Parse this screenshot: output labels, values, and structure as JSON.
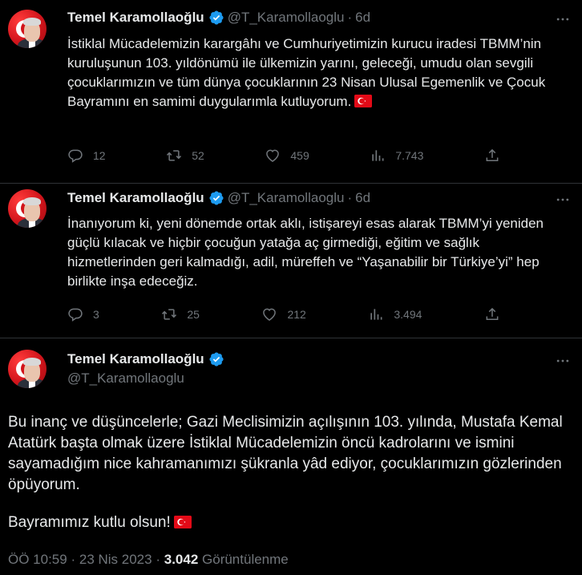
{
  "tweets": [
    {
      "name": "Temel Karamollaoğlu",
      "handle": "@T_Karamollaoglu",
      "separator": "·",
      "time": "6d",
      "text": "İstiklal Mücadelemizin karargâhı ve Cumhuriyetimizin kurucu iradesi TBMM’nin kuruluşunun 103. yıldönümü ile ülkemizin yarını, geleceği, umudu olan sevgili çocuklarımızın ve tüm dünya çocuklarının 23 Nisan Ulusal Egemenlik ve Çocuk Bayramını en samimi duygularımla kutluyorum.",
      "replies": "12",
      "retweets": "52",
      "likes": "459",
      "views": "7.743"
    },
    {
      "name": "Temel Karamollaoğlu",
      "handle": "@T_Karamollaoglu",
      "separator": "·",
      "time": "6d",
      "text": "İnanıyorum ki, yeni dönemde ortak aklı, istişareyi esas alarak TBMM’yi yeniden güçlü kılacak ve hiçbir çocuğun yatağa aç girmediği, eğitim ve sağlık hizmetlerinden geri kalmadığı, adil, müreffeh ve “Yaşanabilir bir Türkiye’yi” hep birlikte inşa edeceğiz.",
      "replies": "3",
      "retweets": "25",
      "likes": "212",
      "views": "3.494"
    }
  ],
  "main": {
    "name": "Temel Karamollaoğlu",
    "handle": "@T_Karamollaoglu",
    "paragraph1": "Bu inanç ve düşüncelerle; Gazi Meclisimizin açılışının 103. yılında, Mustafa Kemal Atatürk başta olmak üzere İstiklal Mücadelemizin öncü kadrolarını ve ismini sayamadığım nice kahramanımızı şükranla yâd ediyor, çocuklarımızın gözlerinden öpüyorum.",
    "paragraph2": "Bayramımız kutlu olsun!",
    "time": "ÖÖ 10:59",
    "separator": "·",
    "date": "23 Nis 2023",
    "views_count": "3.042",
    "views_label": "Görüntülenme"
  },
  "colors": {
    "background": "#000000",
    "text": "#e7e9ea",
    "secondary": "#71767b",
    "verified": "#1d9bf0",
    "divider": "#2f3336",
    "flag": "#e30a17"
  },
  "icons": [
    "verified-badge-icon",
    "more-icon",
    "reply-icon",
    "retweet-icon",
    "like-icon",
    "views-icon",
    "share-icon",
    "turkish-flag-icon"
  ]
}
